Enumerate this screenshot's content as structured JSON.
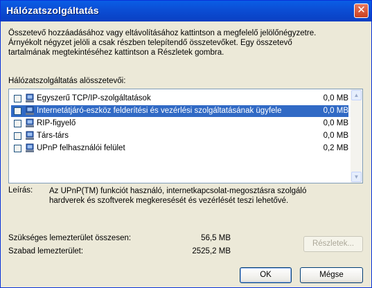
{
  "window": {
    "title": "Hálózatszolgáltatás",
    "close_symbol": "✕"
  },
  "description": {
    "line1": "Összetevő hozzáadásához vagy eltávolításához kattintson a megfelelő jelölőnégyzetre.",
    "line2": "Árnyékolt négyzet jelöli a csak részben telepítendő összetevőket. Egy összetevő",
    "line3": "tartalmának megtekintéséhez kattintson a Részletek gombra."
  },
  "components": {
    "label": "Hálózatszolgáltatás alösszetevői:",
    "items": [
      {
        "name": "Egyszerű TCP/IP-szolgáltatások",
        "size": "0,0 MB",
        "checked": false,
        "selected": false
      },
      {
        "name": "Internetátjáró-eszköz felderítési és vezérlési szolgáltatásának ügyfele",
        "size": "0,0 MB",
        "checked": false,
        "selected": true
      },
      {
        "name": "RIP-figyelő",
        "size": "0,0 MB",
        "checked": false,
        "selected": false
      },
      {
        "name": "Társ-társ",
        "size": "0,0 MB",
        "checked": false,
        "selected": false
      },
      {
        "name": "UPnP felhasználói felület",
        "size": "0,2 MB",
        "checked": false,
        "selected": false
      }
    ]
  },
  "info": {
    "label": "Leírás:",
    "line1": "Az UPnP(TM) funkciót használó, internetkapcsolat-megosztásra szolgáló",
    "line2": "hardverek és szoftverek megkeresését és vezérlését teszi lehetővé."
  },
  "disk": {
    "required_label": "Szükséges lemezterület összesen:",
    "required_value": "56,5 MB",
    "free_label": "Szabad lemezterület:",
    "free_value": "2525,2 MB"
  },
  "buttons": {
    "details": "Részletek...",
    "ok": "OK",
    "cancel": "Mégse"
  },
  "colors": {
    "titlebar": "#0b4fd6",
    "selection": "#316ac5",
    "dialog": "#ece9d8",
    "close": "#c9401f"
  }
}
